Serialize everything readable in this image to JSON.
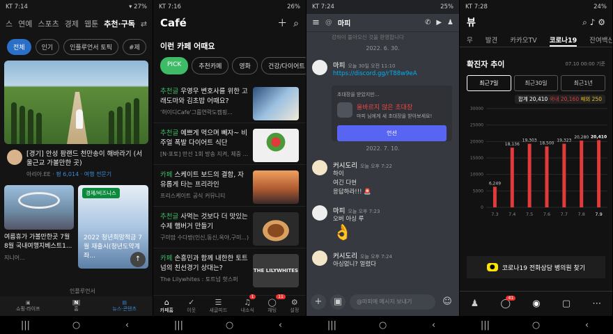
{
  "status": [
    {
      "time": "KT 7:14",
      "battery": "27%"
    },
    {
      "time": "KT 7:16",
      "battery": "26%"
    },
    {
      "time": "KT 7:24",
      "battery": "25%"
    },
    {
      "time": "KT 7:28",
      "battery": "24%"
    }
  ],
  "p1": {
    "tabs": [
      "스",
      "연예",
      "스포츠",
      "경제",
      "웹툰",
      "추천·구독"
    ],
    "chips": [
      "전체",
      "인기",
      "인플루언서 토픽",
      "#제"
    ],
    "card1_title": "[경기] 안성 팜랜드 천만송이 해바라기 (서울근교 가볼만한 곳)",
    "card1_author": "아리아.EE",
    "card1_stats": "평 6,014 · 여행 전문기",
    "card2_badge": "경제/비즈니스",
    "card2_title": "여름휴가 가볼만한곳 7월 8월 국내여행지베스트1...",
    "card2_author": "지니어...",
    "card3_title": "2022 청년희망적금 7월 재출시(청년도약계좌...",
    "card3_author": "인플루언서",
    "bottom": [
      "쇼핑·라이프",
      "홈",
      "뉴스·콘텐츠"
    ]
  },
  "p2": {
    "logo": "Café",
    "section": "이런 카페 어때요",
    "pills": [
      "PICK",
      "추천카페",
      "영화",
      "건강/다이어트"
    ],
    "posts": [
      {
        "cat": "추천글",
        "title": "우영우 변호사를 위한 고래도마와 김초밥 어때요?",
        "sub": "'허이디Cafe'그룹연락도캠핑..."
      },
      {
        "cat": "추천글",
        "title": "예쁘게 먹으며 빼자~ 비주얼 폭발 다이어트 식단",
        "sub": "[N·포토] 만선 1회 방송 지켜, 체중 ..."
      },
      {
        "cat": "카페",
        "title": "스케이트 보드의 결함, 자유롭게 타는 프리라인",
        "sub": "프리스케이트 공식 커뮤니티"
      },
      {
        "cat": "추천글",
        "title": "사먹는 것보다 더 맛있는 수제 햄버거 만들기",
        "sub": "구미맘 수다방(인신,동신,옥야,구미...)"
      },
      {
        "cat": "카페",
        "title": "손흥민과 함께 내한한 토트넘의 친선경기 상대는?",
        "sub": "The Lilywhites : 토트넘 핫스퍼"
      }
    ],
    "thumb_text": "THE LILYWHITES",
    "bar": [
      {
        "label": "카페홈",
        "badge": ""
      },
      {
        "label": "이웃",
        "badge": ""
      },
      {
        "label": "새글피드",
        "badge": ""
      },
      {
        "label": "내소식",
        "badge": "1"
      },
      {
        "label": "채팅",
        "badge": "11"
      },
      {
        "label": "설정",
        "badge": ""
      }
    ]
  },
  "p3": {
    "channel": "마피",
    "top_text": "강하이 돌아오신 것을 환영합니다",
    "date1": "2022. 6. 30.",
    "user1": "마피",
    "ts1": "오늘 30일 오전 11:10",
    "link": "https://discord.gg/rT88w9eA",
    "invite_head": "초대장을 받았지만...",
    "invite_title": "올바르지 않은 초대장",
    "invite_desc": "마피 님에게 새 초대장을 받아보세요!",
    "invite_btn": "언션",
    "date2": "2022. 7. 10.",
    "user2": "커시도리",
    "ts2": "오늘 오후 7:22",
    "lines2": [
      "하이",
      "여긴 다현",
      "응답하라!!! 🚨"
    ],
    "ts3": "오늘 오후 7:23",
    "line3": "오버 아싱 루",
    "ts4": "오늘 오후 7:24",
    "line4": "아싱없니? 얼렸다",
    "input_ph": "@마피에 메시지 보내기"
  },
  "p4": {
    "title": "뷰",
    "tabs": [
      "무",
      "발견",
      "카카오TV",
      "코로나19",
      "잔여백신"
    ],
    "section": "확진자 추이",
    "updated": "07.10 00:00 기준",
    "segments": [
      "최근7일",
      "최근30일",
      "최근1년"
    ],
    "legend_total": "합계 20,410",
    "legend_local": "국내 20,160",
    "legend_abroad": "해외 250",
    "banner": "코로나19 전화상담 병의원 찾기",
    "nav_badge": "41"
  },
  "chart_data": {
    "type": "bar",
    "title": "확진자 추이",
    "categories": [
      "7.3",
      "7.4",
      "7.5",
      "7.6",
      "7.7",
      "7.8",
      "7.9"
    ],
    "values": [
      6249,
      18136,
      19303,
      18500,
      19323,
      20280,
      20410
    ],
    "value_labels": [
      "6,249",
      "18,136",
      "19,303",
      "18,500",
      "19,323",
      "20,280",
      "20,410"
    ],
    "yticks": [
      "30000",
      "25000",
      "20000",
      "15000",
      "10000",
      "5000",
      "0"
    ],
    "ylim": [
      0,
      30000
    ],
    "color": "#e03a3a"
  }
}
